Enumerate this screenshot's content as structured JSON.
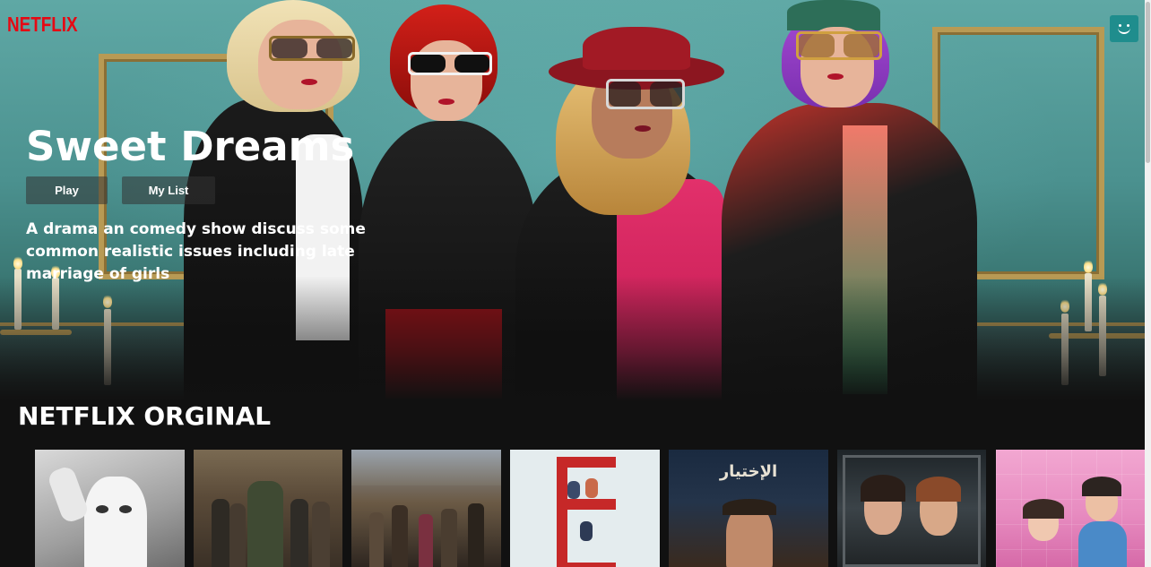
{
  "header": {
    "logo": "NETFLIX",
    "avatar_icon": "smiley-avatar-icon"
  },
  "hero": {
    "title": "Sweet Dreams",
    "play_label": "Play",
    "mylist_label": "My List",
    "description": "A drama an comedy show discuss some common realistic issues including late marriage of girls"
  },
  "row": {
    "title": "NETFLIX ORGINAL",
    "posters": [
      {
        "name": "poster-1"
      },
      {
        "name": "poster-2"
      },
      {
        "name": "poster-3"
      },
      {
        "name": "poster-4"
      },
      {
        "name": "poster-5",
        "text": "الإختيار"
      },
      {
        "name": "poster-6"
      },
      {
        "name": "poster-7"
      }
    ]
  },
  "colors": {
    "brand_red": "#e50914",
    "background": "#111111",
    "avatar_teal": "#1f8d8d",
    "button_bg": "#333333"
  }
}
